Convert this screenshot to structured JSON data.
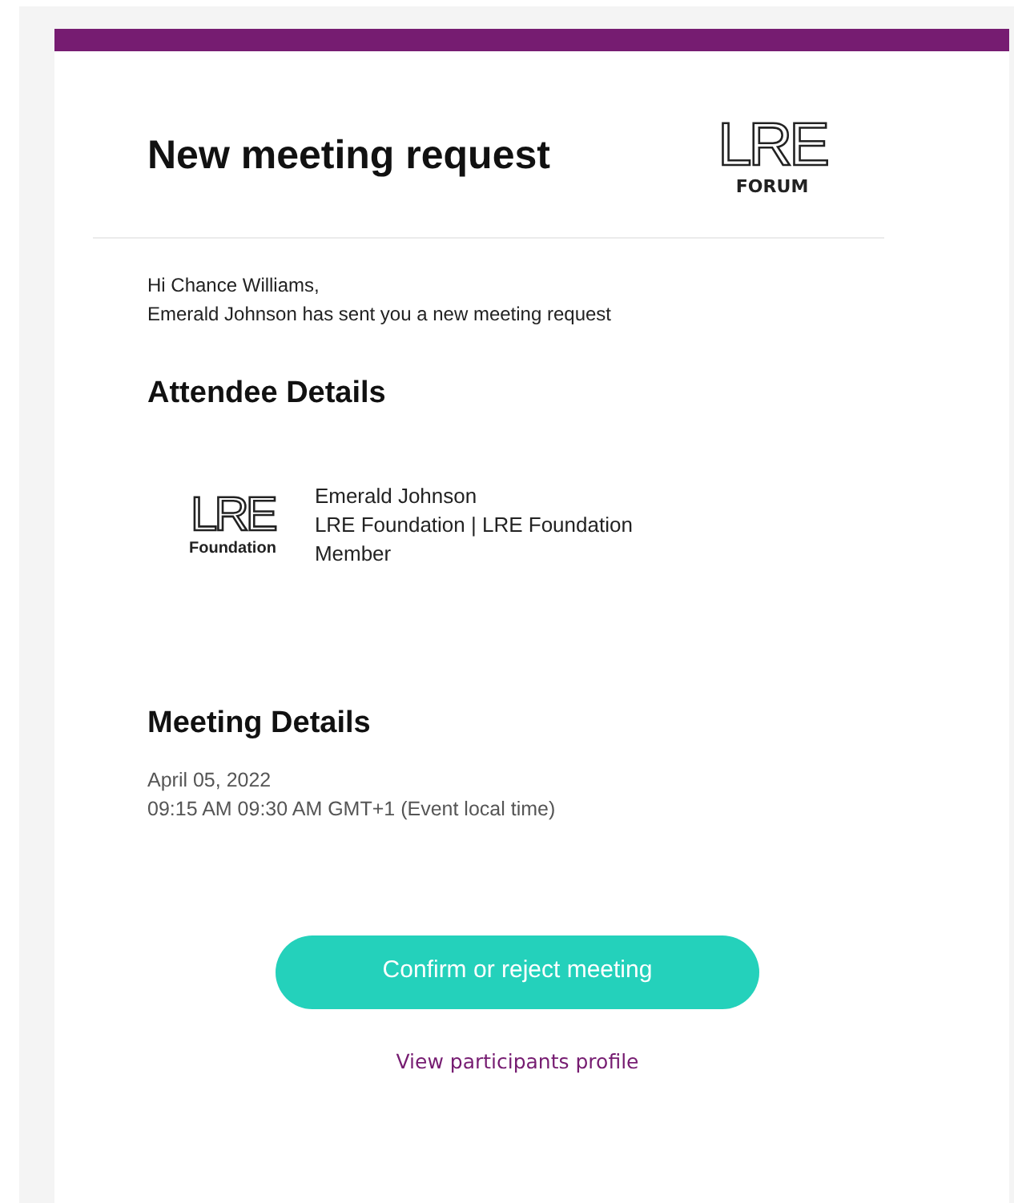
{
  "header": {
    "title": "New meeting request",
    "logo": {
      "mark": "LRE",
      "caption": "FORUM"
    }
  },
  "greeting": "Hi Chance Williams,",
  "intro": "Emerald Johnson has sent you a new meeting request",
  "attendee_section": {
    "heading": "Attendee Details",
    "logo": {
      "mark": "LRE",
      "caption": "Foundation"
    },
    "lines": [
      "Emerald Johnson",
      "LRE Foundation | LRE Foundation",
      "Member"
    ]
  },
  "meeting_section": {
    "heading": "Meeting Details",
    "date": "April 05, 2022",
    "time": "09:15 AM 09:30 AM GMT+1 (Event local time)"
  },
  "button": "Confirm or reject meeting",
  "link": "View participants profile"
}
